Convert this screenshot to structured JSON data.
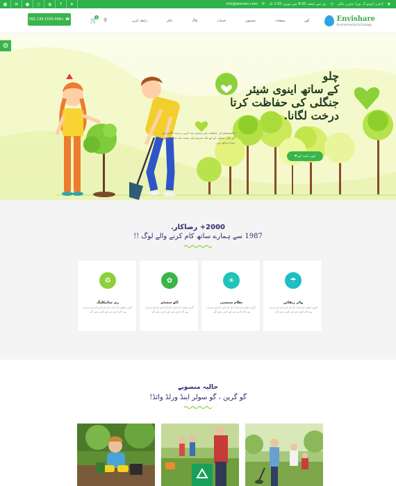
{
  "topbar": {
    "social_icons": [
      "grid-icon",
      "mail-icon",
      "pinterest-icon",
      "rss-icon",
      "skype-icon",
      "facebook-icon",
      "twitter-icon"
    ],
    "address": "ادیٹرز ایونیو 2، بورڈ سٹرن مالی",
    "hours": "پیر سے جمعہ 8:00 سے دوپہر 1:00 تک",
    "email": "info@domain.com"
  },
  "header": {
    "logo_title": "Envishare",
    "logo_tagline": "Environmental & Ecology",
    "donate_label": "091 139 1559 008+",
    "cart_count": "0",
    "nav_items": [
      "گھر",
      "صفحات",
      "مضمون",
      "خدمات",
      "بلاگ",
      "دکان",
      "رابطہ کریں"
    ]
  },
  "hero": {
    "title_line1": "چلو",
    "title_line2_a": "کے ساتھ ",
    "title_line2_b": "اینوی شیئر",
    "title_line3": "جنگلی کی حفاظت کرتا",
    "title_line4": "درخت لگانا.",
    "description": "ایکوسسٹم کی حفاظت میں ہماری مدد کریں، درخت لگائیں اور آنے والی نسلوں کے لیے ایک سرسبز اور صحت مند دنیا بنانے میں ہمارا ساتھ دیں۔",
    "button_label": "ابھی حصہ لیں"
  },
  "counter": {
    "title": "2000+ رضاکار.",
    "subtitle": "1987 سے ہمارے ساتھ کام کرنے والے لوگ !!"
  },
  "services": [
    {
      "title": "ری سائیکلنگ",
      "icon": "recycle-icon",
      "text": "گرین ہاؤس کے اثرات کو کم کرنے کے لیے ہم ہر روز کام کرتے ہیں اور کرتے رہیں گے۔"
    },
    {
      "title": "اکو سسٹم",
      "icon": "leaf-icon",
      "text": "گرین ہاؤس کے اثرات کو کم کرنے کے لیے ہم ہر روز کام کرتے ہیں اور کرتے رہیں گے۔"
    },
    {
      "title": "نظام شمسی",
      "icon": "sun-icon",
      "text": "گرین ہاؤس کے اثرات کو کم کرنے کے لیے ہم ہر روز کام کرتے ہیں اور کرتے رہیں گے۔"
    },
    {
      "title": "واٹر ریفائن",
      "icon": "drop-icon",
      "text": "گرین ہاؤس کے اثرات کو کم کرنے کے لیے ہم ہر روز کام کرتے ہیں اور کرتے رہیں گے۔"
    }
  ],
  "projects": {
    "title": "حالیہ منصوبے",
    "subtitle": "گو گرین ، گو سولر اینڈ ورلڈ وائڈ!"
  },
  "colors": {
    "accent": "#39b54a",
    "navy": "#2f2a6e",
    "teal": "#20c4b8",
    "lime": "#8dd13a"
  }
}
